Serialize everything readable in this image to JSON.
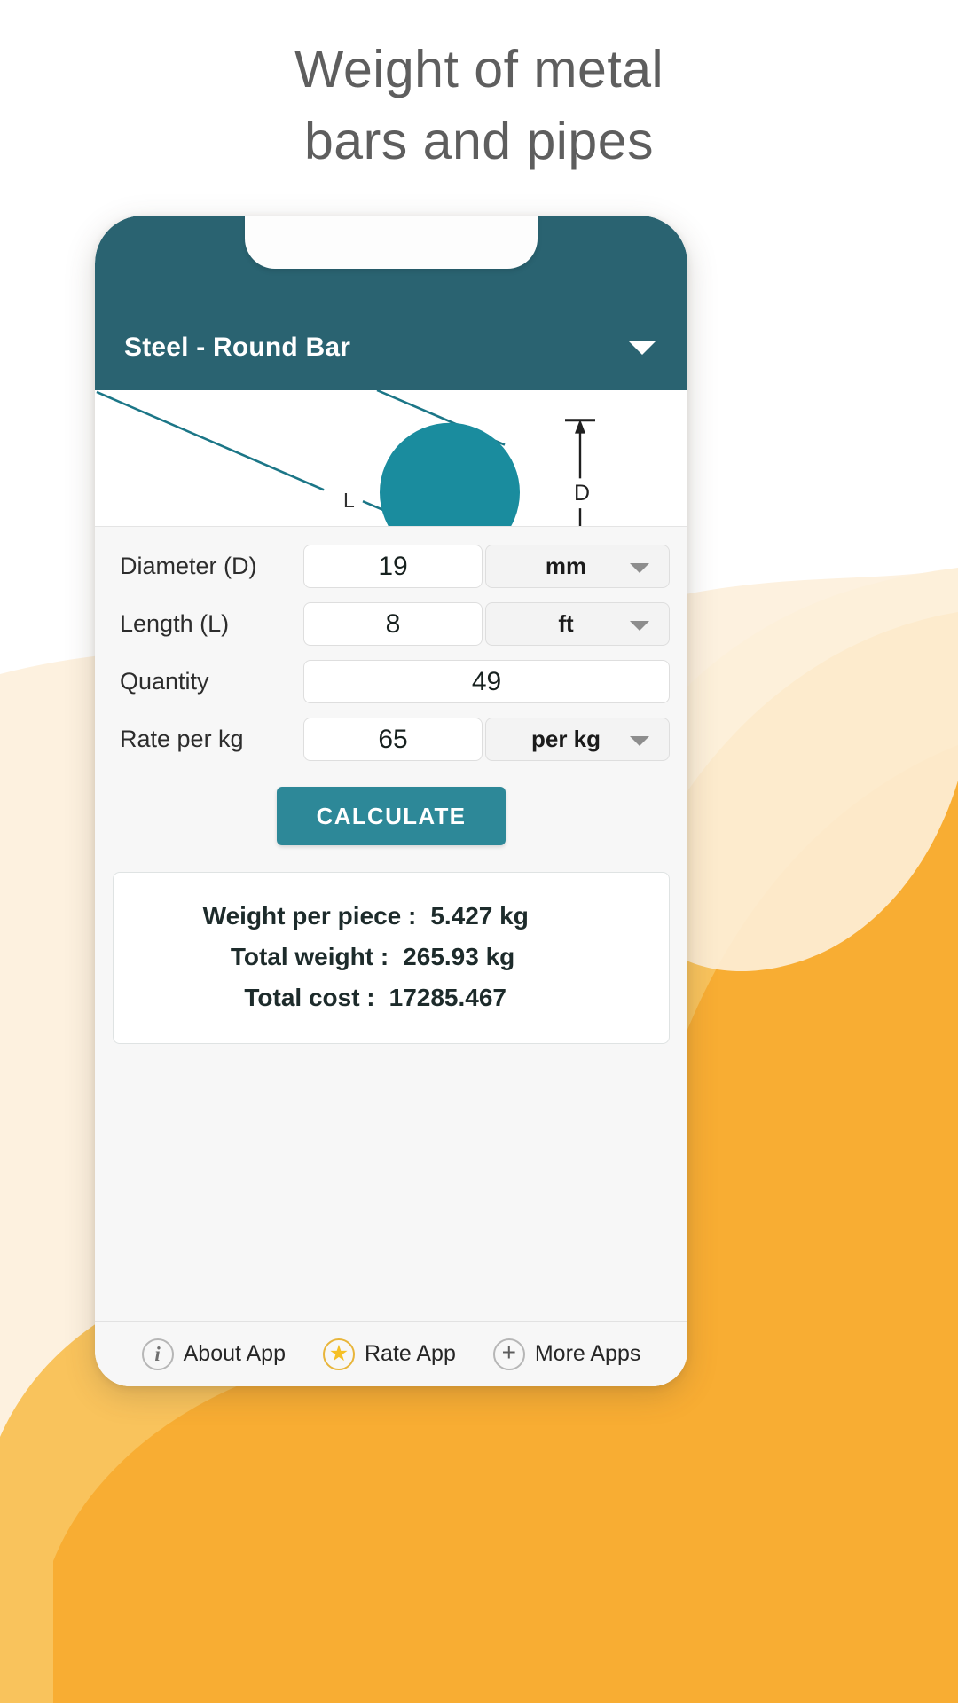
{
  "promo": {
    "headline_line1": "Weight of metal",
    "headline_line2": "bars and pipes",
    "headline_color": "#5e5e5e",
    "background_color": "#ffffff",
    "accent_orange": "#f6a623",
    "accent_cream": "#fce9cc"
  },
  "app": {
    "header": {
      "title": "Steel - Round Bar",
      "dropdown_icon": "chevron-down-icon",
      "background_color": "#2a6371",
      "text_color": "#ffffff"
    },
    "diagram": {
      "shape": "round-bar-cross-section",
      "length_label": "L",
      "diameter_label": "D",
      "fill_color": "#1a8c9e",
      "line_color": "#1b7687"
    },
    "form": {
      "rows": [
        {
          "label": "Diameter (D)",
          "value": "19",
          "unit": "mm",
          "has_unit": true,
          "unit_icon": "chevron-down-icon"
        },
        {
          "label": "Length (L)",
          "value": "8",
          "unit": "ft",
          "has_unit": true,
          "unit_icon": "chevron-down-icon"
        },
        {
          "label": "Quantity",
          "value": "49",
          "unit": "",
          "has_unit": false,
          "unit_icon": ""
        },
        {
          "label": "Rate per kg",
          "value": "65",
          "unit": "per kg",
          "has_unit": true,
          "unit_icon": "chevron-down-icon"
        }
      ],
      "calculate_label": "CALCULATE",
      "calculate_color": "#2d8898"
    },
    "results": {
      "rows": [
        {
          "label": "Weight per piece :",
          "value": "5.427 kg"
        },
        {
          "label": "Total weight :",
          "value": "265.93 kg"
        },
        {
          "label": "Total cost :",
          "value": "17285.467"
        }
      ]
    },
    "bottom_nav": {
      "items": [
        {
          "label": "About App",
          "icon": "info-icon",
          "glyph": "i"
        },
        {
          "label": "Rate App",
          "icon": "star-icon",
          "glyph": "★"
        },
        {
          "label": "More Apps",
          "icon": "plus-icon",
          "glyph": "+"
        }
      ]
    }
  }
}
